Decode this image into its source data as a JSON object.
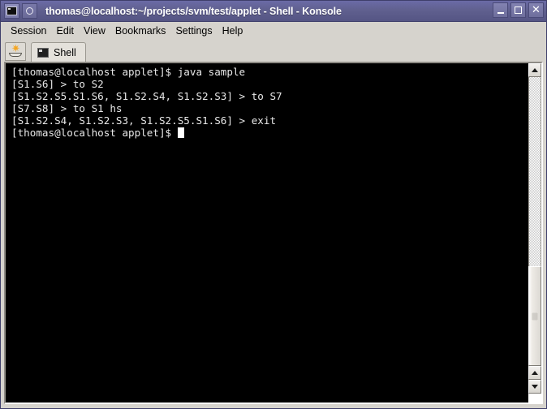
{
  "window": {
    "title": "thomas@localhost:~/projects/svm/test/applet - Shell - Konsole",
    "app_icon": "terminal-icon",
    "session_icon": "oval-icon",
    "minimize_label": "_",
    "maximize_label": "□",
    "close_label": "✕"
  },
  "menubar": {
    "items": [
      {
        "label": "Session"
      },
      {
        "label": "Edit"
      },
      {
        "label": "View"
      },
      {
        "label": "Bookmarks"
      },
      {
        "label": "Settings"
      },
      {
        "label": "Help"
      }
    ]
  },
  "tabbar": {
    "new_session_icon": "new-session-icon",
    "tabs": [
      {
        "label": "Shell",
        "icon": "terminal-icon",
        "active": true
      }
    ]
  },
  "terminal": {
    "lines": [
      "[thomas@localhost applet]$ java sample",
      "[S1.S6] > to S2",
      "[S1.S2.S5.S1.S6, S1.S2.S4, S1.S2.S3] > to S7",
      "[S7.S8] > to S1 hs",
      "[S1.S2.S4, S1.S2.S3, S1.S2.S5.S1.S6] > exit",
      "[thomas@localhost applet]$ "
    ],
    "prompt_line_index": 5,
    "cursor": "block",
    "foreground_color": "#e8e8e8",
    "background_color": "#000000"
  },
  "scrollbar": {
    "top_arrow_icon": "arrow-up-icon",
    "bottom_up_arrow_icon": "arrow-up-icon",
    "bottom_down_arrow_icon": "arrow-down-icon",
    "orientation": "vertical"
  },
  "colors": {
    "titlebar": "#60608f",
    "chrome": "#d6d3cd",
    "terminal_bg": "#000000",
    "terminal_fg": "#e8e8e8"
  }
}
